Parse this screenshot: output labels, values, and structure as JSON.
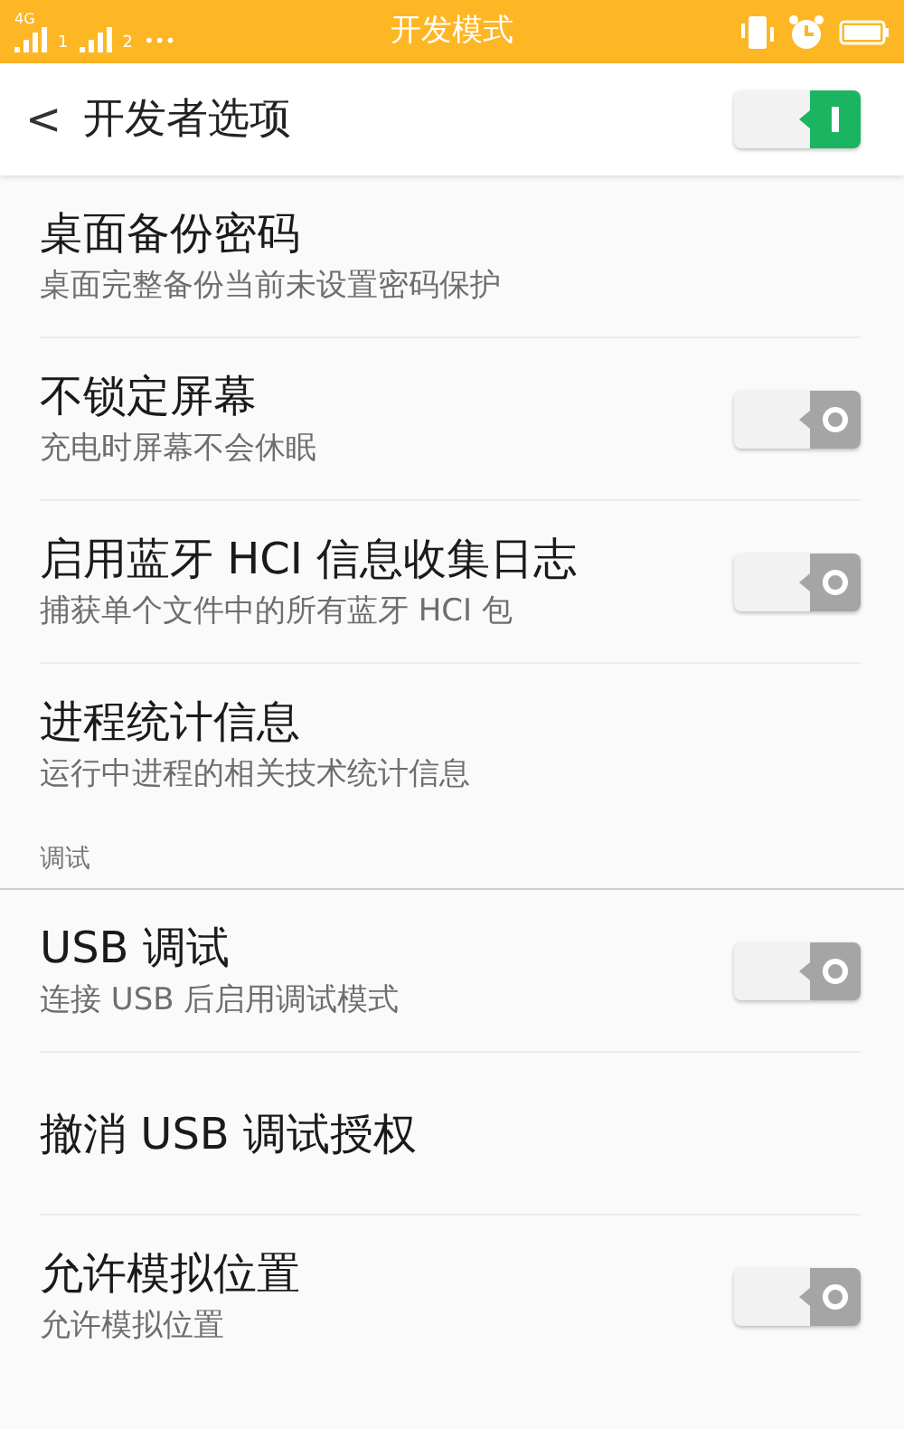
{
  "status_bar": {
    "network": "4G",
    "sims": [
      "1",
      "2"
    ],
    "more": "•••",
    "title": "开发模式"
  },
  "header": {
    "back": "<",
    "title": "开发者选项",
    "toggle_on": true
  },
  "sections": [
    {
      "items": [
        {
          "kind": "plain",
          "title": "桌面备份密码",
          "subtitle": "桌面完整备份当前未设置密码保护"
        },
        {
          "kind": "toggle",
          "title": "不锁定屏幕",
          "subtitle": "充电时屏幕不会休眠",
          "on": false
        },
        {
          "kind": "toggle",
          "title": "启用蓝牙 HCI 信息收集日志",
          "subtitle": "捕获单个文件中的所有蓝牙 HCI 包",
          "on": false
        },
        {
          "kind": "plain",
          "title": "进程统计信息",
          "subtitle": "运行中进程的相关技术统计信息"
        }
      ]
    },
    {
      "header": "调试",
      "items": [
        {
          "kind": "toggle",
          "title": "USB 调试",
          "subtitle": "连接 USB 后启用调试模式",
          "on": false
        },
        {
          "kind": "plain",
          "title": "撤消 USB 调试授权"
        },
        {
          "kind": "toggle",
          "title": "允许模拟位置",
          "subtitle": "允许模拟位置",
          "on": false
        }
      ]
    }
  ]
}
